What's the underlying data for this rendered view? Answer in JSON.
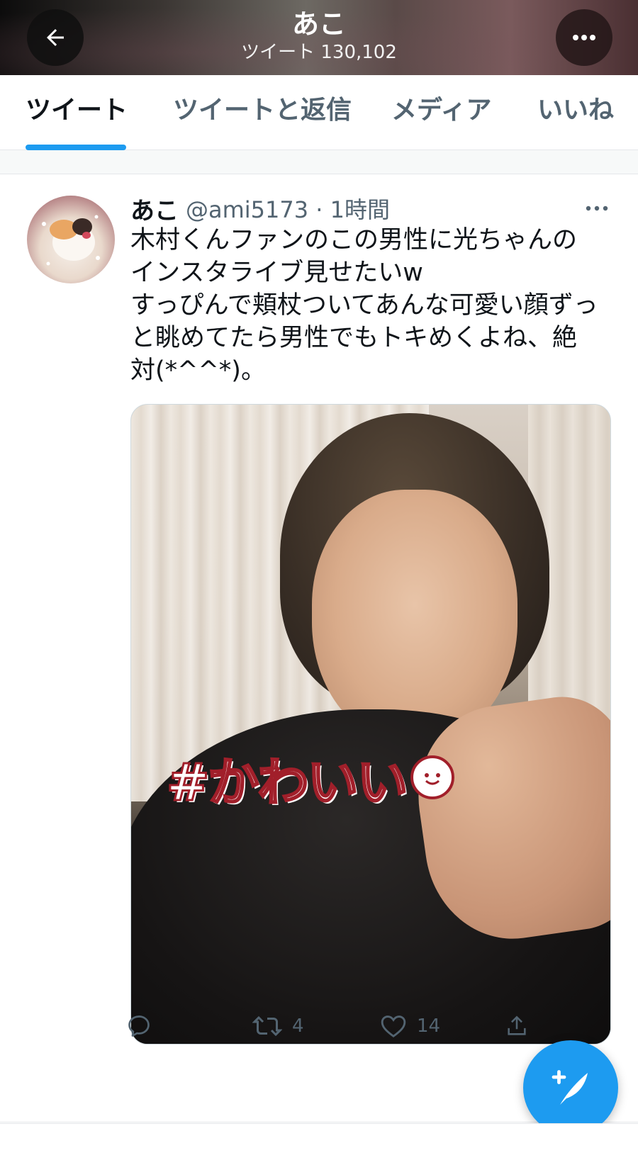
{
  "header": {
    "title": "あこ",
    "subtitle": "ツイート 130,102",
    "back_icon": "arrow-left-icon",
    "more_icon": "ellipsis-icon"
  },
  "tabs": [
    {
      "label": "ツイート",
      "active": true
    },
    {
      "label": "ツイートと返信",
      "active": false
    },
    {
      "label": "メディア",
      "active": false
    },
    {
      "label": "いいね",
      "active": false
    }
  ],
  "tweet": {
    "name": "あこ",
    "handle_time": "@ami5173 · 1時間",
    "text_lines": [
      "木村くんファンのこの男性に光ちゃんの",
      "インスタライブ見せたいw",
      "すっぴんで頬杖ついてあんな可愛い顔ずっ",
      "と眺めてたら男性でもトキめくよね、絶",
      "対(*^^*)。"
    ],
    "media_sticker": "#かわいい",
    "actions": {
      "reply": "",
      "retweet": "4",
      "like": "14",
      "share": ""
    }
  },
  "colors": {
    "accent": "#1d9bf0",
    "secondary_text": "#536471",
    "primary_text": "#0f1419"
  }
}
